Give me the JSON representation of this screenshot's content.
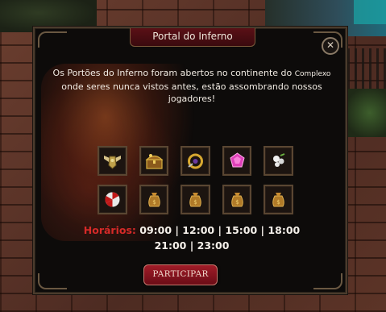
{
  "dialog": {
    "title": "Portal do Inferno",
    "close_glyph": "✕",
    "message_part1": "Os Portões do Inferno foram abertos no continente do ",
    "message_place": "Complexo",
    "message_part2": " onde seres nunca vistos antes, estão assombrando nossos jogadores!",
    "rewards": [
      {
        "icon": "winged-armor-icon"
      },
      {
        "icon": "treasure-chest-icon"
      },
      {
        "icon": "golden-ring-icon"
      },
      {
        "icon": "pink-gem-icon"
      },
      {
        "icon": "white-orb-cluster-icon"
      },
      {
        "icon": "umbrella-shield-icon"
      },
      {
        "icon": "gold-bag-icon"
      },
      {
        "icon": "gold-bag-icon"
      },
      {
        "icon": "gold-bag-icon"
      },
      {
        "icon": "gold-bag-icon"
      }
    ],
    "schedule_label": "Horários:",
    "schedule_line1": "09:00 | 12:00 | 15:00 | 18:00",
    "schedule_line2": "21:00 | 23:00",
    "join_label": "PARTICIPAR"
  },
  "colors": {
    "accent_red": "#d52a28",
    "title_bg": "#4a0d12",
    "button_bg": "#8a1420"
  }
}
